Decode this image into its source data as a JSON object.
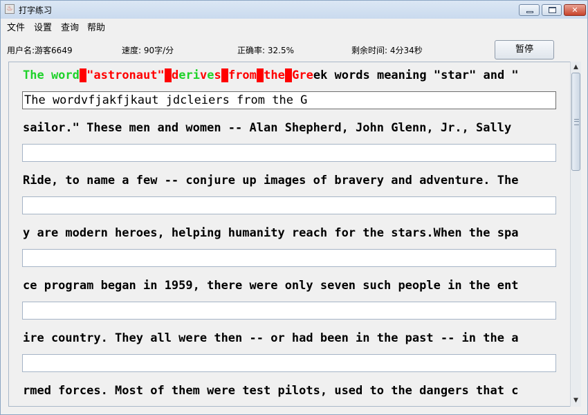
{
  "window": {
    "title": "打字练习",
    "icon": "java-cup-icon"
  },
  "menu": [
    "文件",
    "设置",
    "查询",
    "帮助"
  ],
  "status": {
    "user": "用户名:游客6649",
    "speed": "速度: 90字/分",
    "accuracy": "正确率: 32.5%",
    "time_left": "剩余时间: 4分34秒",
    "pause_label": "暂停"
  },
  "lines": [
    {
      "tokens": [
        {
          "t": "The word",
          "s": "ok"
        },
        {
          "t": " ",
          "s": "badbg"
        },
        {
          "t": "\"astronaut\"",
          "s": "bad"
        },
        {
          "t": " ",
          "s": "badbg"
        },
        {
          "t": "d",
          "s": "bad"
        },
        {
          "t": "eri",
          "s": "ok"
        },
        {
          "t": "v",
          "s": "bad"
        },
        {
          "t": "e",
          "s": "ok"
        },
        {
          "t": "s",
          "s": "bad"
        },
        {
          "t": " ",
          "s": "badbg"
        },
        {
          "t": "from",
          "s": "bad"
        },
        {
          "t": " ",
          "s": "badbg"
        },
        {
          "t": "the",
          "s": "bad"
        },
        {
          "t": " ",
          "s": "badbg"
        },
        {
          "t": "Gre",
          "s": "bad"
        },
        {
          "t": "ek words meaning \"star\" and \"",
          "s": "pend"
        }
      ],
      "input": "The wordvfjakfjkaut jdcleiers from the G"
    },
    {
      "tokens": [
        {
          "t": "sailor.\" These men and women -- Alan Shepherd, John Glenn, Jr., Sally",
          "s": "pend"
        }
      ],
      "input": ""
    },
    {
      "tokens": [
        {
          "t": "Ride, to name a few -- conjure up images of bravery and adventure. The",
          "s": "pend"
        }
      ],
      "input": ""
    },
    {
      "tokens": [
        {
          "t": "y are modern heroes, helping humanity reach for the stars.When the spa",
          "s": "pend"
        }
      ],
      "input": ""
    },
    {
      "tokens": [
        {
          "t": "ce program began in 1959, there were only seven such people in the ent",
          "s": "pend"
        }
      ],
      "input": ""
    },
    {
      "tokens": [
        {
          "t": "ire country. They all were then -- or had been in the past -- in the a",
          "s": "pend"
        }
      ],
      "input": ""
    },
    {
      "tokens": [
        {
          "t": "rmed forces. Most of them were test pilots, used to the dangers that c",
          "s": "pend"
        }
      ],
      "input": ""
    }
  ],
  "colors": {
    "correct": "#1fd22a",
    "wrong": "#ff0000",
    "pending": "#000000"
  }
}
